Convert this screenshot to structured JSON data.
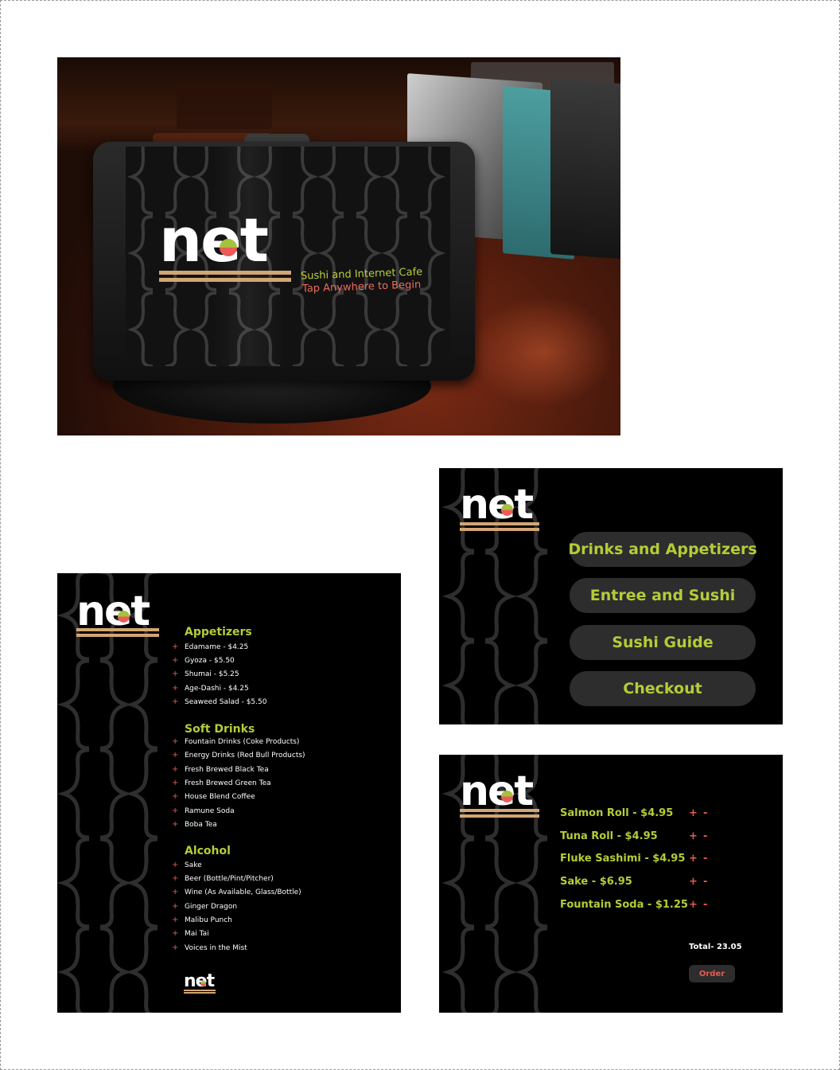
{
  "brand": {
    "logo_text": "net",
    "colors": {
      "accent_green": "#b5cc37",
      "accent_red": "#e85a4f",
      "bar_tan": "#d2a574",
      "background": "#000000"
    }
  },
  "splash": {
    "tagline": "Sushi and Internet Cafe",
    "prompt": "Tap Anywhere to Begin"
  },
  "menu_list": {
    "sections": [
      {
        "title": "Appetizers",
        "items": [
          "Edamame - $4.25",
          "Gyoza - $5.50",
          "Shumai - $5.25",
          "Age-Dashi - $4.25",
          "Seaweed Salad - $5.50"
        ]
      },
      {
        "title": "Soft Drinks",
        "items": [
          "Fountain Drinks (Coke Products)",
          "Energy Drinks (Red Bull Products)",
          "Fresh Brewed Black Tea",
          "Fresh Brewed Green Tea",
          "House Blend Coffee",
          "Ramune Soda",
          "Boba Tea"
        ]
      },
      {
        "title": "Alcohol",
        "items": [
          "Sake",
          "Beer (Bottle/Pint/Pitcher)",
          "Wine (As Available, Glass/Bottle)",
          "Ginger Dragon",
          "Malibu Punch",
          "Mai Tai",
          "Voices in the Mist"
        ]
      }
    ],
    "bullet": "+",
    "footer_logo": "net"
  },
  "home": {
    "buttons": [
      "Drinks and Appetizers",
      "Entree and Sushi",
      "Sushi Guide",
      "Checkout"
    ]
  },
  "order": {
    "lines": [
      "Salmon Roll - $4.95",
      "Tuna Roll - $4.95",
      "Fluke Sashimi - $4.95",
      "Sake - $6.95",
      "Fountain Soda - $1.25"
    ],
    "plus_label": "+",
    "minus_label": "-",
    "total": "Total- 23.05",
    "order_button": "Order"
  }
}
